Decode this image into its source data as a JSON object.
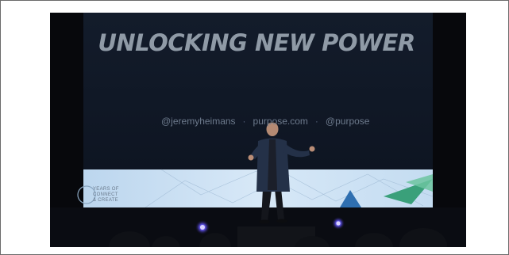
{
  "slide": {
    "title": "UNLOCKING NEW POWER",
    "handle_1": "@jeremyheimans",
    "separator": "·",
    "handle_2": "purpose.com",
    "handle_3": "@purpose"
  },
  "banner": {
    "line_1": "YEARS OF",
    "line_2": "CONNECT",
    "line_3": "& CREATE"
  },
  "colors": {
    "screen": "#111a29",
    "stage_floor": "#0a0c12",
    "banner": "#c9dff2",
    "accent_green": "#3aa07a",
    "accent_blue": "#2f6fb0",
    "stage_light": "#6a5cff"
  }
}
